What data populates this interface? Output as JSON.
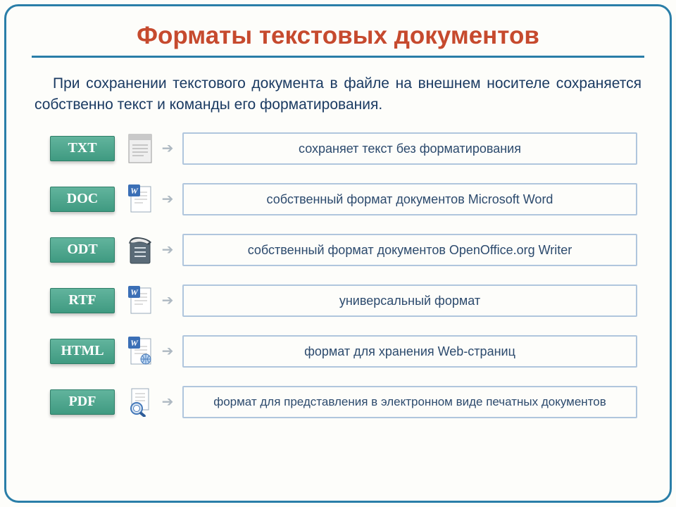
{
  "title": "Форматы текстовых документов",
  "intro": "При сохранении текстового документа в файле на внешнем носителе сохраняется собственно текст и команды его форматирования.",
  "formats": [
    {
      "badge": "TXT",
      "icon": "txt",
      "desc": "сохраняет текст без форматирования"
    },
    {
      "badge": "DOC",
      "icon": "doc",
      "desc": "собственный формат документов Microsoft Word"
    },
    {
      "badge": "ODT",
      "icon": "odt",
      "desc": "собственный формат документов OpenOffice.org Writer"
    },
    {
      "badge": "RTF",
      "icon": "rtf",
      "desc": "универсальный формат"
    },
    {
      "badge": "HTML",
      "icon": "html",
      "desc": "формат для хранения Web-страниц"
    },
    {
      "badge": "PDF",
      "icon": "pdf",
      "desc": "формат для представления в электронном виде печатных документов"
    }
  ]
}
